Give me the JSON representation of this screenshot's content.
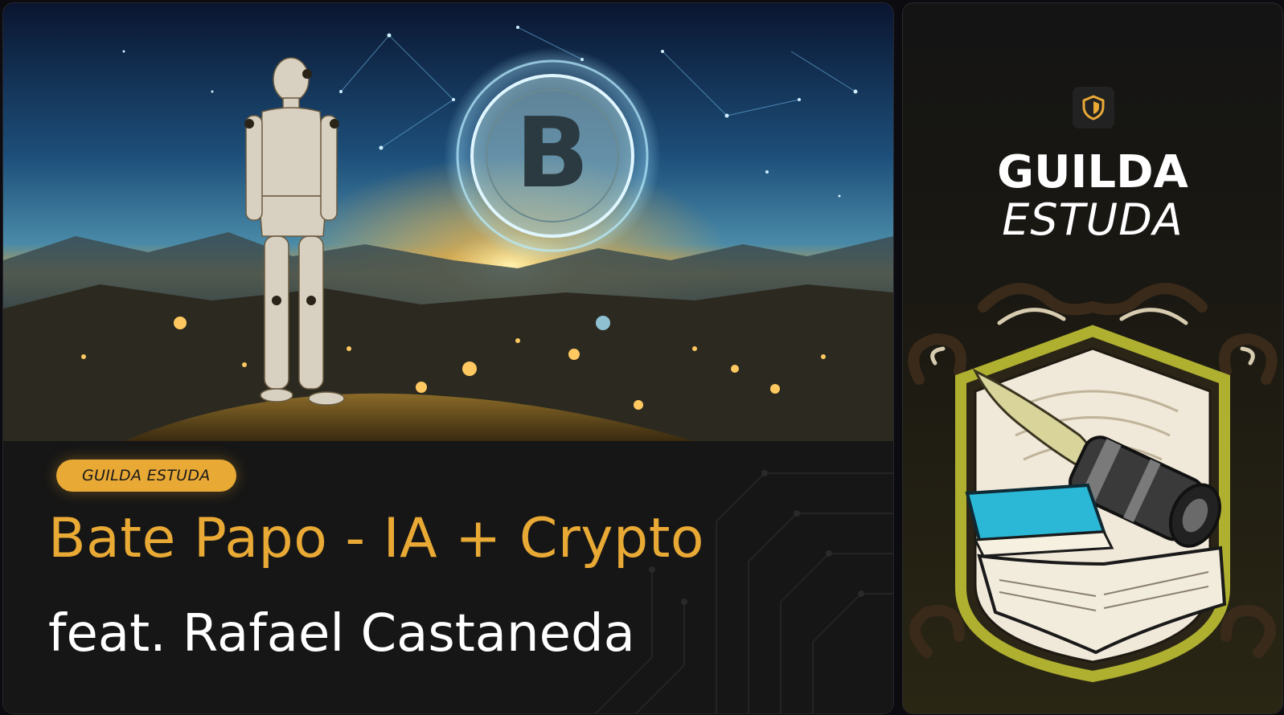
{
  "left_card": {
    "badge": "GUILDA ESTUDA",
    "title": "Bate Papo - IA + Crypto",
    "subtitle": "feat. Rafael Castaneda"
  },
  "right_card": {
    "brand_line_1": "GUILDA",
    "brand_line_2": "ESTUDA",
    "logo_icon": "shield-icon"
  },
  "colors": {
    "accent": "#e9a935",
    "background": "#161616",
    "text": "#ffffff"
  }
}
